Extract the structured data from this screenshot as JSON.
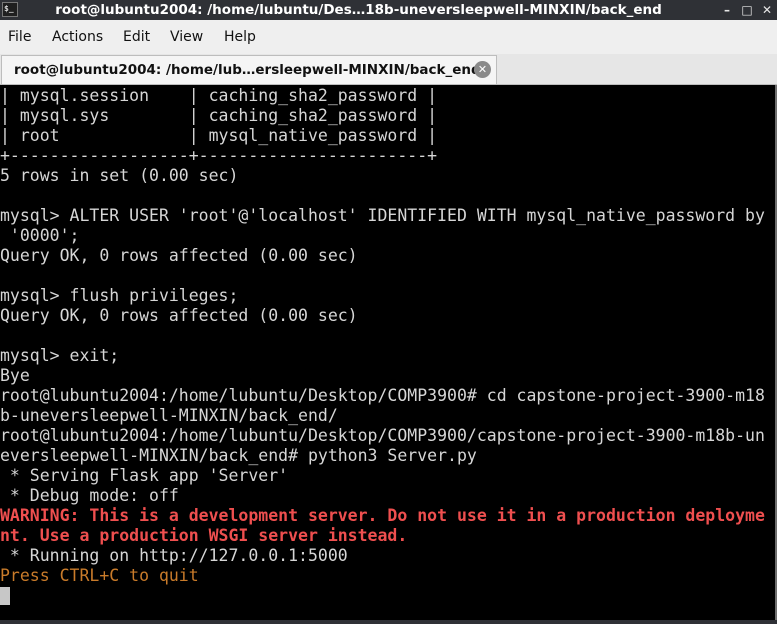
{
  "window": {
    "title": "root@lubuntu2004: /home/lubuntu/Des…18b-uneversleepwell-MINXIN/back_end",
    "app_icon_label": "$_",
    "buttons": {
      "minimize": "–",
      "maximize": "□",
      "close": "✕"
    }
  },
  "menu": {
    "items": [
      "File",
      "Actions",
      "Edit",
      "View",
      "Help"
    ]
  },
  "tab": {
    "label": "root@lubuntu2004: /home/lub…ersleepwell-MINXIN/back_end",
    "close_icon": "✕"
  },
  "terminal": {
    "lines": [
      "| mysql.session    | caching_sha2_password |",
      "| mysql.sys        | caching_sha2_password |",
      "| root             | mysql_native_password |",
      "+------------------+-----------------------+",
      "5 rows in set (0.00 sec)",
      "",
      "mysql> ALTER USER 'root'@'localhost' IDENTIFIED WITH mysql_native_password by",
      " '0000';",
      "Query OK, 0 rows affected (0.00 sec)",
      "",
      "mysql> flush privileges;",
      "Query OK, 0 rows affected (0.00 sec)",
      "",
      "mysql> exit;",
      "Bye",
      "root@lubuntu2004:/home/lubuntu/Desktop/COMP3900# cd capstone-project-3900-m18",
      "b-uneversleepwell-MINXIN/back_end/",
      "root@lubuntu2004:/home/lubuntu/Desktop/COMP3900/capstone-project-3900-m18b-un",
      "eversleepwell-MINXIN/back_end# python3 Server.py",
      " * Serving Flask app 'Server'",
      " * Debug mode: off",
      "WARNING: This is a development server. Do not use it in a production deployme",
      "nt. Use a production WSGI server instead.",
      " * Running on http://127.0.0.1:5000",
      "Press CTRL+C to quit"
    ],
    "warning_line_indexes": [
      21,
      22
    ],
    "hint_line_indexes": [
      24
    ]
  },
  "colors": {
    "terminal_bg": "#000000",
    "terminal_fg": "#d6d6d6",
    "warning": "#ef4f4f",
    "hint": "#c97b2a",
    "titlebar_bg": "#2f3136",
    "menubar_bg": "#efefef"
  }
}
